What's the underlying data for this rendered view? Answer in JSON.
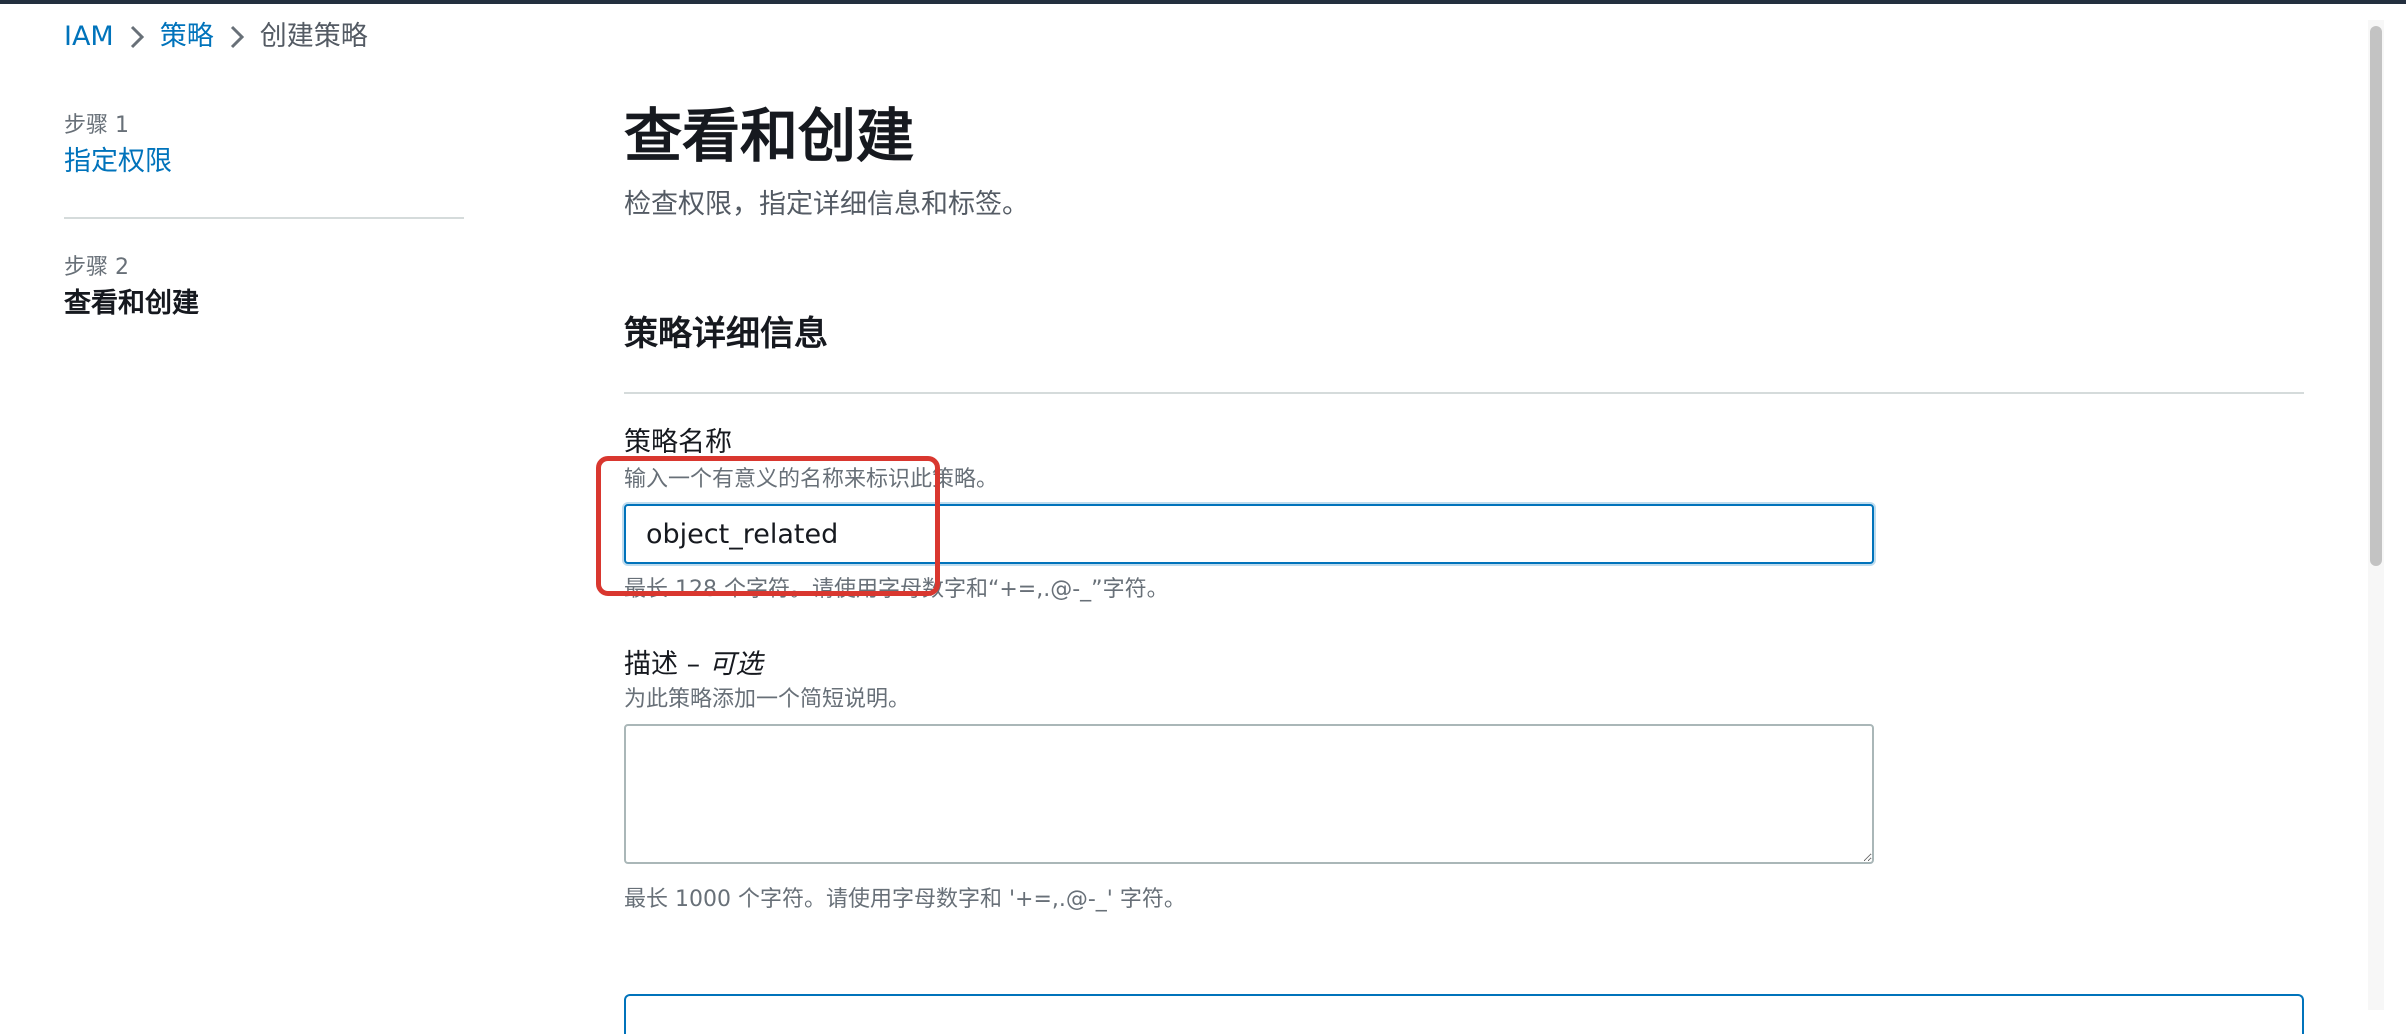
{
  "breadcrumb": {
    "items": [
      {
        "label": "IAM"
      },
      {
        "label": "策略"
      },
      {
        "label": "创建策略"
      }
    ]
  },
  "steps": [
    {
      "label": "步骤 1",
      "title": "指定权限"
    },
    {
      "label": "步骤 2",
      "title": "查看和创建"
    }
  ],
  "page": {
    "title": "查看和创建",
    "subtitle": "检查权限，指定详细信息和标签。"
  },
  "details": {
    "section_title": "策略详细信息",
    "name": {
      "label": "策略名称",
      "description": "输入一个有意义的名称来标识此策略。",
      "value": "object_related",
      "constraint": "最长 128 个字符。请使用字母数字和“+=,.@-_”字符。"
    },
    "description": {
      "label": "描述 –",
      "optional": "可选",
      "description": "为此策略添加一个简短说明。",
      "value": "",
      "constraint": "最长 1000 个字符。请使用字母数字和 '+=,.@-_' 字符。"
    }
  },
  "colors": {
    "link": "#0073bb",
    "highlight": "#d9372f",
    "text": "#16191f",
    "muted": "#687078"
  }
}
